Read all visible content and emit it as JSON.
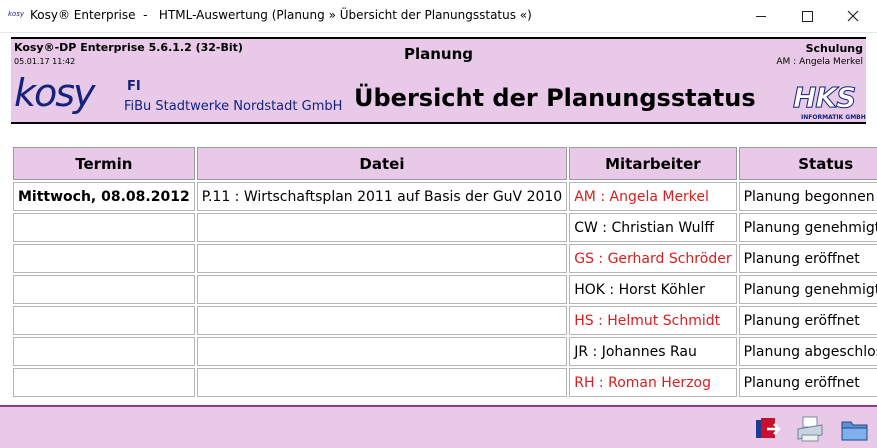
{
  "window": {
    "app_name": "Kosy® Enterprise",
    "title": "HTML-Auswertung (Planung » Übersicht der Planungsstatus «)",
    "icon_text": "kosy"
  },
  "header": {
    "product": "Kosy®-DP Enterprise 5.6.1.2 (32-Bit)",
    "date": "05.01.17 11:42",
    "module": "Planung",
    "mode": "Schulung",
    "user": "AM : Angela Merkel",
    "logo_text": "kosy",
    "logo_suffix": "FI",
    "company": "FiBu Stadtwerke Nordstadt GmbH",
    "heading": "Übersicht der Planungsstatus",
    "partner_logo": "HKS",
    "partner_sub": "INFORMATIK GMBH"
  },
  "table": {
    "columns": [
      "Termin",
      "Datei",
      "Mitarbeiter",
      "Status"
    ],
    "rows": [
      {
        "termin": "Mittwoch, 08.08.2012",
        "datei": "P.11 : Wirtschaftsplan 2011 auf Basis der GuV 2010",
        "mitarbeiter": "AM : Angela Merkel",
        "status": "Planung begonnen",
        "highlight": true
      },
      {
        "termin": "",
        "datei": "",
        "mitarbeiter": "CW : Christian Wulff",
        "status": "Planung genehmigt",
        "highlight": false
      },
      {
        "termin": "",
        "datei": "",
        "mitarbeiter": "GS : Gerhard Schröder",
        "status": "Planung eröffnet",
        "highlight": true
      },
      {
        "termin": "",
        "datei": "",
        "mitarbeiter": "HOK : Horst Köhler",
        "status": "Planung genehmigt",
        "highlight": false
      },
      {
        "termin": "",
        "datei": "",
        "mitarbeiter": "HS : Helmut Schmidt",
        "status": "Planung eröffnet",
        "highlight": true
      },
      {
        "termin": "",
        "datei": "",
        "mitarbeiter": "JR : Johannes Rau",
        "status": "Planung abgeschlossen",
        "highlight": false
      },
      {
        "termin": "",
        "datei": "",
        "mitarbeiter": "RH : Roman Herzog",
        "status": "Planung eröffnet",
        "highlight": true
      }
    ]
  },
  "footer": {
    "icons": [
      "exit-icon",
      "print-icon",
      "folder-icon"
    ]
  },
  "colors": {
    "header_bg": "#e8c9e8",
    "highlight_text": "#d81e1e",
    "brand_blue": "#13237e"
  }
}
